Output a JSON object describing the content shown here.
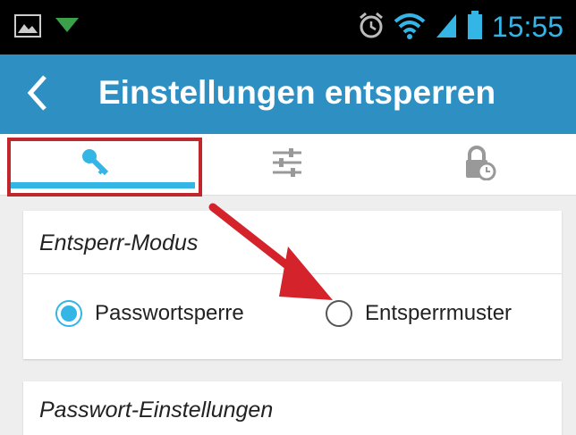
{
  "status_bar": {
    "time": "15:55",
    "icons": [
      "image-icon",
      "download-icon",
      "alarm-icon",
      "wifi-icon",
      "signal-icon",
      "battery-icon"
    ]
  },
  "action_bar": {
    "back_icon": "back-arrow-icon",
    "title": "Einstellungen entsperren"
  },
  "tabs": [
    {
      "icon": "key-icon",
      "selected": true
    },
    {
      "icon": "sliders-icon",
      "selected": false
    },
    {
      "icon": "lock-clock-icon",
      "selected": false
    }
  ],
  "unlock_mode": {
    "title": "Entsperr-Modus",
    "options": [
      {
        "label": "Passwortsperre",
        "checked": true
      },
      {
        "label": "Entsperrmuster",
        "checked": false
      }
    ]
  },
  "next_section": {
    "title": "Passwort-Einstellungen"
  },
  "colors": {
    "accent": "#33b5e5",
    "action_bar": "#2d8fc2",
    "annotation_red": "#c0272d"
  }
}
